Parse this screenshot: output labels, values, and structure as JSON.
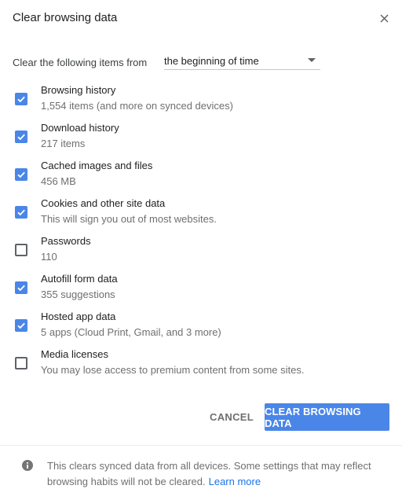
{
  "dialog": {
    "title": "Clear browsing data",
    "close_icon": "close-icon"
  },
  "range": {
    "label": "Clear the following items from",
    "selected": "the beginning of time"
  },
  "items": [
    {
      "label": "Browsing history",
      "sub": "1,554 items (and more on synced devices)",
      "checked": true
    },
    {
      "label": "Download history",
      "sub": "217 items",
      "checked": true
    },
    {
      "label": "Cached images and files",
      "sub": "456 MB",
      "checked": true
    },
    {
      "label": "Cookies and other site data",
      "sub": "This will sign you out of most websites.",
      "checked": true
    },
    {
      "label": "Passwords",
      "sub": "110",
      "checked": false
    },
    {
      "label": "Autofill form data",
      "sub": "355 suggestions",
      "checked": true
    },
    {
      "label": "Hosted app data",
      "sub": "5 apps (Cloud Print, Gmail, and 3 more)",
      "checked": true
    },
    {
      "label": "Media licenses",
      "sub": "You may lose access to premium content from some sites.",
      "checked": false
    }
  ],
  "buttons": {
    "cancel": "CANCEL",
    "clear": "CLEAR BROWSING DATA"
  },
  "footer": {
    "text": "This clears synced data from all devices. Some settings that may reflect browsing habits will not be cleared.",
    "link": "Learn more"
  },
  "colors": {
    "accent": "#4a86e8",
    "link": "#1a73e8"
  }
}
